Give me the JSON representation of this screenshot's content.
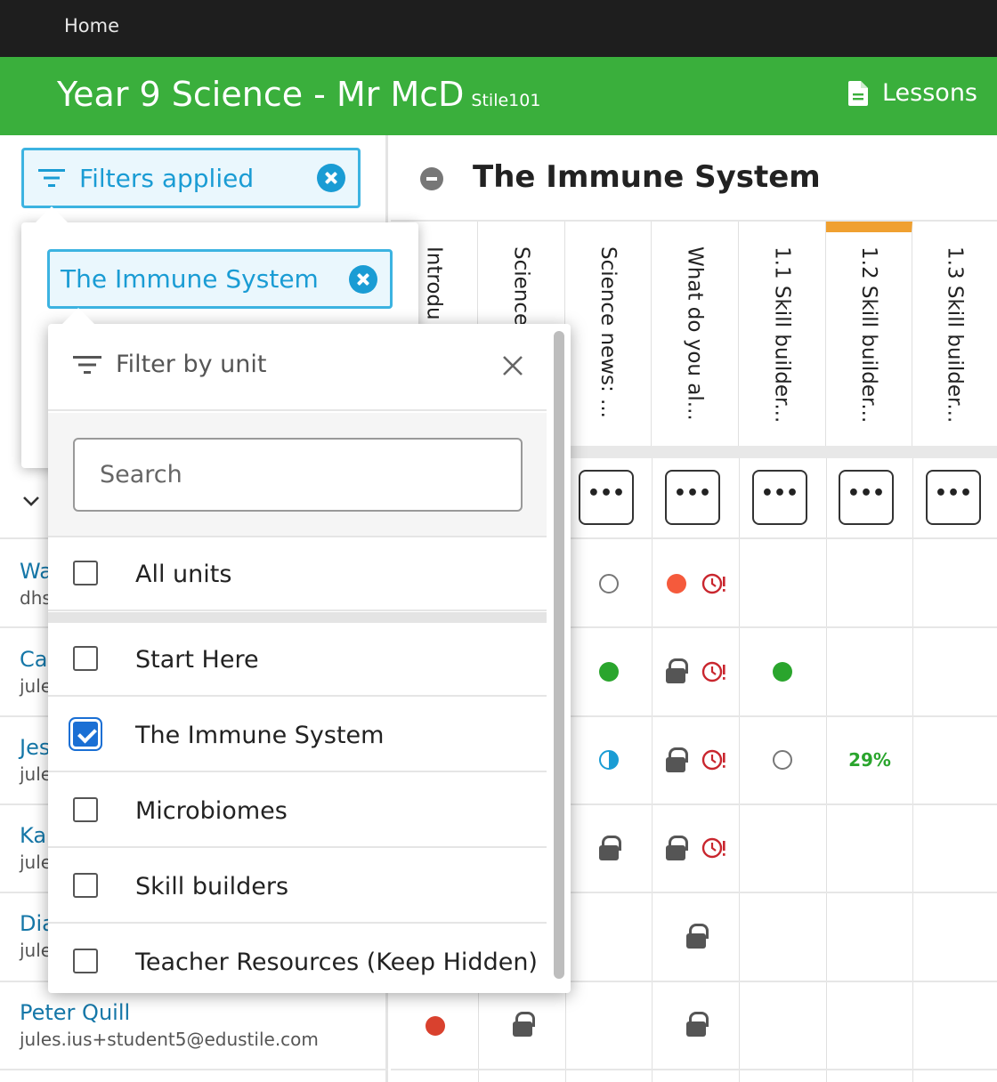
{
  "topbar": {
    "home_label": "Home"
  },
  "header": {
    "title": "Year 9 Science - Mr McD",
    "class_code": "Stile101",
    "lessons_label": "Lessons",
    "bg_color": "#3aaf3c"
  },
  "unit": {
    "title": "The Immune System"
  },
  "columns": [
    "Introdu",
    "Science",
    "Science news: ...",
    "What do you al...",
    "1.1 Skill builder...",
    "1.2 Skill builder...",
    "1.3 Skill builder..."
  ],
  "menu_glyph": "•••",
  "students": [
    {
      "name": "Wa",
      "email": "dhs"
    },
    {
      "name": "Ca",
      "email": "jule"
    },
    {
      "name": "Jes",
      "email": "jule"
    },
    {
      "name": "Ka",
      "email": "jule"
    },
    {
      "name": "Dia",
      "email": "jule"
    },
    {
      "name": "Peter Quill",
      "email": "jules.ius+student5@edustile.com"
    }
  ],
  "grid": {
    "percent_value": "29%"
  },
  "filters": {
    "applied_label": "Filters applied",
    "unit_chip": "The Immune System"
  },
  "filter_dropdown": {
    "title": "Filter by unit",
    "search_placeholder": "Search",
    "all_units": {
      "label": "All units",
      "checked": false
    },
    "options": [
      {
        "label": "Start Here",
        "checked": false
      },
      {
        "label": "The Immune System",
        "checked": true
      },
      {
        "label": "Microbiomes",
        "checked": false
      },
      {
        "label": "Skill builders",
        "checked": false
      },
      {
        "label": "Teacher Resources (Keep Hidden)",
        "checked": false
      }
    ]
  },
  "colors": {
    "accent_blue": "#1a9cd4",
    "complete_green": "#2aa52d",
    "warning_orange": "#f0a030",
    "overdue_red": "#c9262e",
    "started_red": "#f55a3c"
  }
}
